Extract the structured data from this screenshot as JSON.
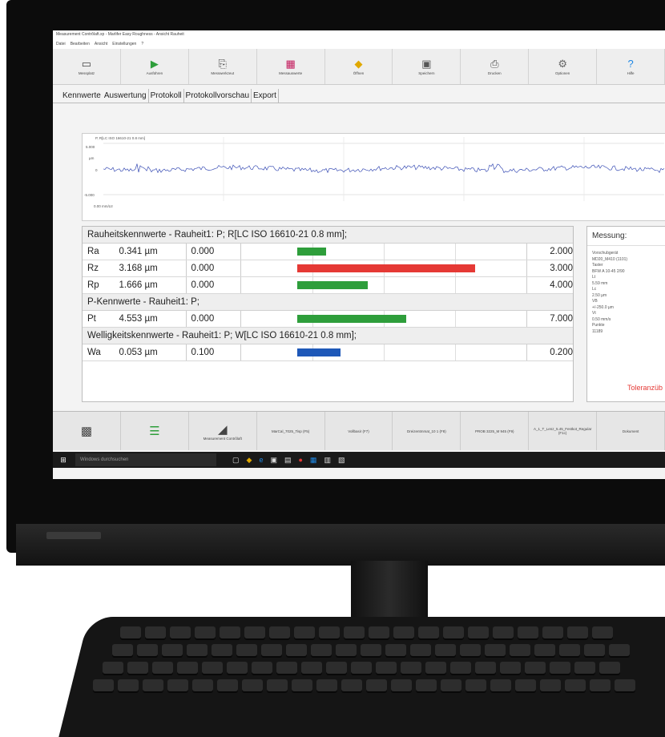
{
  "window": {
    "title": "Measurement Contrôlaft.xp - Marlifer Easy Roughness - Ansicht Rauheit",
    "menu": [
      "Datei",
      "Bearbeiten",
      "Ansicht",
      "Einstellungen",
      "?"
    ]
  },
  "ribbon": [
    {
      "label": "Messplatz",
      "icon": "monitor-icon"
    },
    {
      "label": "Ausführen",
      "icon": "play-icon"
    },
    {
      "label": "Messwerkzeut",
      "icon": "tool-icon"
    },
    {
      "label": "Messauswerte",
      "icon": "chart-icon"
    },
    {
      "label": "Öffnen",
      "icon": "folder-icon"
    },
    {
      "label": "Speichern",
      "icon": "save-icon"
    },
    {
      "label": "Drucken",
      "icon": "print-icon"
    },
    {
      "label": "Optionen",
      "icon": "gear-icon"
    },
    {
      "label": "Hilfe",
      "icon": "help-icon"
    }
  ],
  "tabs": [
    "Kennwerte",
    "Auswertung",
    "Protokoll",
    "Protokollvorschau",
    "Export"
  ],
  "profile": {
    "title": "P, R[LC ISO 16610-21 0.8 mm]",
    "y_top": "5.000",
    "y_unit": "µm",
    "y_zero": "0",
    "y_bottom": "-5.000",
    "x_label": "0.00 mm/Ltr"
  },
  "results": {
    "sections": [
      {
        "heading": "Rauheitskennwerte - Rauheit1: P; R[LC ISO 16610-21 0.8 mm];",
        "rows": [
          {
            "param": "Ra",
            "value": "0.341 µm",
            "tolerance": "0.000",
            "limit": "2.000",
            "fraction": 0.17,
            "color": "#2e9e3b"
          },
          {
            "param": "Rz",
            "value": "3.168 µm",
            "tolerance": "0.000",
            "limit": "3.000",
            "fraction": 1.06,
            "color": "#e53935"
          },
          {
            "param": "Rp",
            "value": "1.666 µm",
            "tolerance": "0.000",
            "limit": "4.000",
            "fraction": 0.42,
            "color": "#2e9e3b"
          }
        ]
      },
      {
        "heading": "P-Kennwerte - Rauheit1: P;",
        "rows": [
          {
            "param": "Pt",
            "value": "4.553 µm",
            "tolerance": "0.000",
            "limit": "7.000",
            "fraction": 0.65,
            "color": "#2e9e3b"
          }
        ]
      },
      {
        "heading": "Welligkeitskennwerte - Rauheit1: P; W[LC ISO 16610-21 0.8 mm];",
        "rows": [
          {
            "param": "Wa",
            "value": "0.053 µm",
            "tolerance": "0.100",
            "limit": "0.200",
            "fraction": 0.26,
            "color": "#1e58b8"
          }
        ]
      }
    ]
  },
  "side_panel": {
    "title": "Messung:",
    "info": "Vorschubgerät\n  MD20_M410 (1101)\nTaster\n  BFW A 10-45 2/90\nLt\n  5.59 mm\nLc\n  2.50 µm\nVB\n  +/-250.0 µm\nVt\n  0.50 mm/s\nPunkte\n  11189",
    "tolerance_label": "Toleranzüb"
  },
  "bottom_strip": [
    {
      "label": "",
      "icon": "qr-icon"
    },
    {
      "label": "",
      "icon": "layers-icon"
    },
    {
      "label": "Measurement Contrôlaft",
      "icon": "surface-icon"
    },
    {
      "label": "MarCal_7025_Tisp (F5)",
      "icon": ""
    },
    {
      "label": "Vollbasir (F7)",
      "icon": ""
    },
    {
      "label": "Dreizentmmat_10 1 (F8)",
      "icon": ""
    },
    {
      "label": "PROB 3225_M 945 (F9)",
      "icon": ""
    },
    {
      "label": "A_1_T_Lenz_5.45_Festkot_Regular (F1c)",
      "icon": ""
    },
    {
      "label": "Dokument",
      "icon": ""
    }
  ],
  "taskbar": {
    "search_placeholder": "Windows durchsuchen"
  }
}
